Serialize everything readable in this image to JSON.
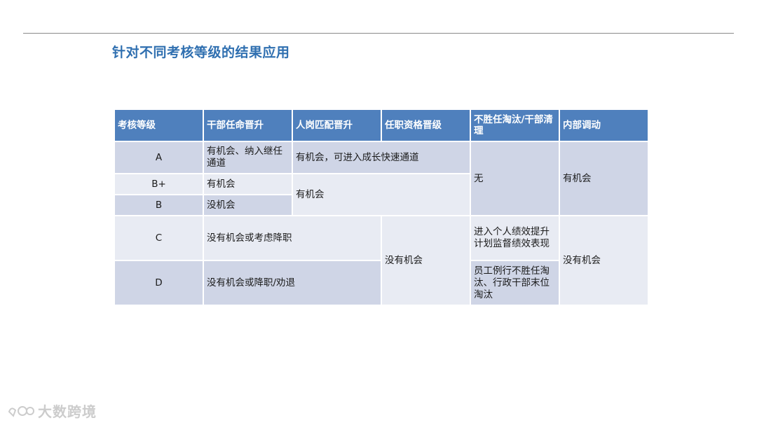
{
  "title": "针对不同考核等级的结果应用",
  "headers": [
    "考核等级",
    "干部任命晋升",
    "人岗匹配晋升",
    "任职资格晋级",
    "不胜任淘汰/干部清理",
    "内部调动"
  ],
  "grades": {
    "a": "A",
    "bplus": "B+",
    "b": "B",
    "c": "C",
    "d": "D"
  },
  "cells": {
    "a_cadre": "有机会、纳入继任通道",
    "a_match_qual": "有机会，可进入成长快速通道",
    "abb_elim": "无",
    "abb_transfer": "有机会",
    "bplus_cadre": "有机会",
    "bb_match_qual": "有机会",
    "b_cadre": "没机会",
    "c_cadre_match": "没有机会或考虑降职",
    "cd_qual": "没有机会",
    "c_elim": "进入个人绩效提升计划监督绩效表现",
    "cd_transfer": "没有机会",
    "d_cadre_match": "没有机会或降职/劝退",
    "d_elim": "员工例行不胜任淘汰、行政干部末位淘汰"
  },
  "watermark": "大数跨境",
  "colors": {
    "header": "#4f80bd",
    "title": "#2f6fb0",
    "cell_dark": "#cfd5e6",
    "cell_light": "#e8ebf3"
  }
}
